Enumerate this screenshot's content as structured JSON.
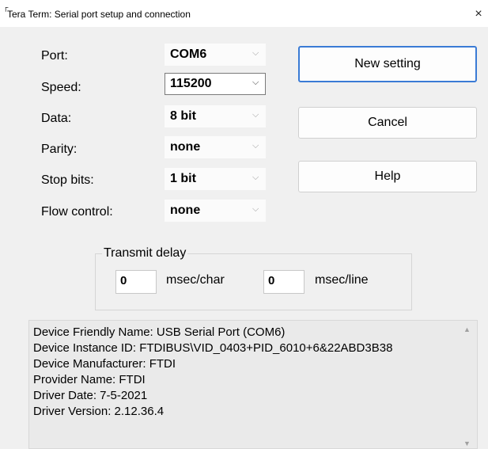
{
  "window": {
    "title": "Tera Term: Serial port setup and connection",
    "close_glyph": "×",
    "app_glyph": "┌"
  },
  "fields": {
    "port": {
      "label": "Port:",
      "value": "COM6"
    },
    "speed": {
      "label": "Speed:",
      "value": "115200"
    },
    "data": {
      "label": "Data:",
      "value": "8 bit"
    },
    "parity": {
      "label": "Parity:",
      "value": "none"
    },
    "stop_bits": {
      "label": "Stop bits:",
      "value": "1 bit"
    },
    "flow_control": {
      "label": "Flow control:",
      "value": "none"
    },
    "chevron": "⌵"
  },
  "buttons": {
    "new_setting": "New setting",
    "cancel": "Cancel",
    "help": "Help"
  },
  "transmit_delay": {
    "legend": "Transmit delay",
    "char_value": "0",
    "char_unit": "msec/char",
    "line_value": "0",
    "line_unit": "msec/line"
  },
  "device_info": {
    "lines": [
      "Device Friendly Name: USB Serial Port (COM6)",
      "Device Instance ID: FTDIBUS\\VID_0403+PID_6010+6&22ABD3B38",
      "Device Manufacturer: FTDI",
      "Provider Name: FTDI",
      "Driver Date: 7-5-2021",
      "Driver Version: 2.12.36.4"
    ],
    "scroll_up": "▲",
    "scroll_down": "▼"
  }
}
